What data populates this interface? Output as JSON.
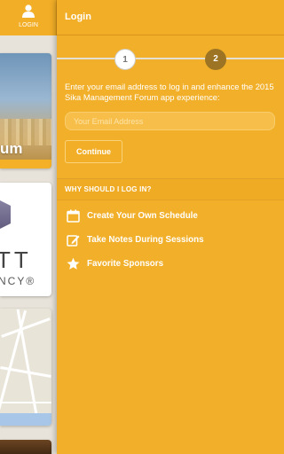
{
  "header": {
    "login_tab_label": "LOGIN",
    "title": "Login"
  },
  "stepper": {
    "steps": [
      "1",
      "2"
    ],
    "current_step": 2
  },
  "form": {
    "intro": "Enter your email address to log in and enhance the 2015 Sika Management Forum app experience:",
    "email_placeholder": "Your Email Address",
    "email_value": "",
    "continue_label": "Continue"
  },
  "why": {
    "heading": "WHY SHOULD I LOG IN?",
    "items": [
      {
        "label": "Create Your Own Schedule",
        "icon": "calendar-icon"
      },
      {
        "label": "Take Notes During Sessions",
        "icon": "edit-note-icon"
      },
      {
        "label": "Favorite Sponsors",
        "icon": "star-icon"
      }
    ]
  },
  "background_cards": {
    "card1_text": "um",
    "card2_text_large": "TT",
    "card2_text_small": "NCY®"
  },
  "colors": {
    "primary": "#f2b02a",
    "header": "#f2ae27",
    "step_active": "#9c7423",
    "text": "#ffffff"
  }
}
